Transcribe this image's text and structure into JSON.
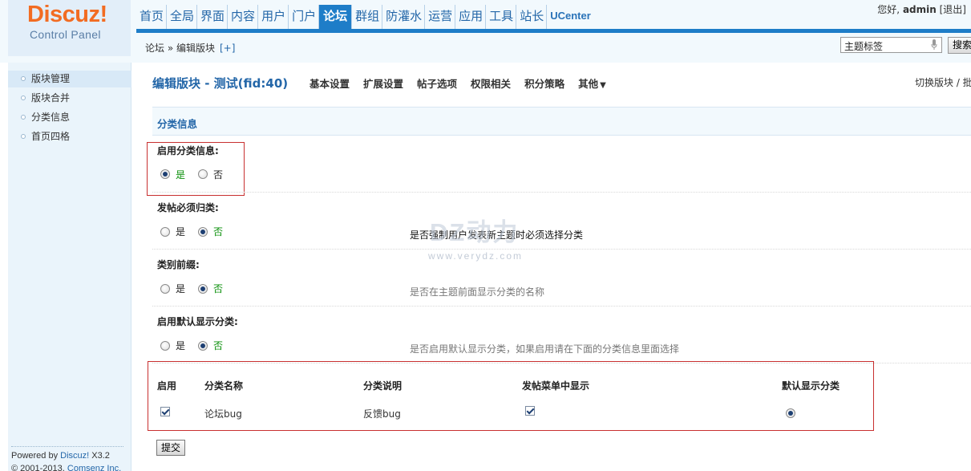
{
  "header": {
    "logo_text": "Discuz",
    "logo_bang": "!",
    "subtitle": "Control Panel",
    "nav": [
      "首页",
      "全局",
      "界面",
      "内容",
      "用户",
      "门户",
      "论坛",
      "群组",
      "防灌水",
      "运营",
      "应用",
      "工具",
      "站长",
      "UCenter"
    ],
    "active_nav": "论坛",
    "greeting": "您好, ",
    "username": "admin",
    "logout": "[退出]",
    "breadcrumb": "论坛 » 编辑版块",
    "add_link": "[+]",
    "search_text": "主题标签",
    "search_button": "搜索"
  },
  "sidebar": {
    "items": [
      "版块管理",
      "版块合并",
      "分类信息",
      "首页四格"
    ],
    "active": "版块管理",
    "powered_prefix": "Powered by ",
    "powered_link": "Discuz!",
    "powered_version": " X3.2",
    "copyright_prefix": "© 2001-2013, ",
    "copyright_link": "Comsenz Inc."
  },
  "main": {
    "title": "编辑版块 - 测试(fid:40)",
    "tabs": [
      "基本设置",
      "扩展设置",
      "帖子选项",
      "权限相关",
      "积分策略",
      "其他"
    ],
    "tab_more_arrow": "▼",
    "switch_forum": "切换版块 / 批",
    "section": "分类信息",
    "settings": [
      {
        "label": "启用分类信息:",
        "yes": "是",
        "no": "否",
        "value": "是",
        "tip": ""
      },
      {
        "label": "发帖必须归类:",
        "yes": "是",
        "no": "否",
        "value": "否",
        "tip": "是否强制用户发表新主题时必须选择分类"
      },
      {
        "label": "类别前缀:",
        "yes": "是",
        "no": "否",
        "value": "否",
        "tip": "是否在主题前面显示分类的名称"
      },
      {
        "label": "启用默认显示分类:",
        "yes": "是",
        "no": "否",
        "value": "否",
        "tip": "是否启用默认显示分类，如果启用请在下面的分类信息里面选择"
      }
    ],
    "table": {
      "headers": [
        "启用",
        "分类名称",
        "分类说明",
        "发帖菜单中显示",
        "默认显示分类"
      ],
      "rows": [
        {
          "enabled": true,
          "name": "论坛bug",
          "desc": "反馈bug",
          "show_in_menu": true,
          "default": true
        }
      ]
    },
    "submit": "提交",
    "watermark": "DZ动力",
    "watermark_url": "www.verydz.com"
  },
  "colors": {
    "accent": "#1e7dc8",
    "logo": "#f26c22",
    "highlight_border": "#c83030",
    "yes_green": "#0a8f0a"
  }
}
